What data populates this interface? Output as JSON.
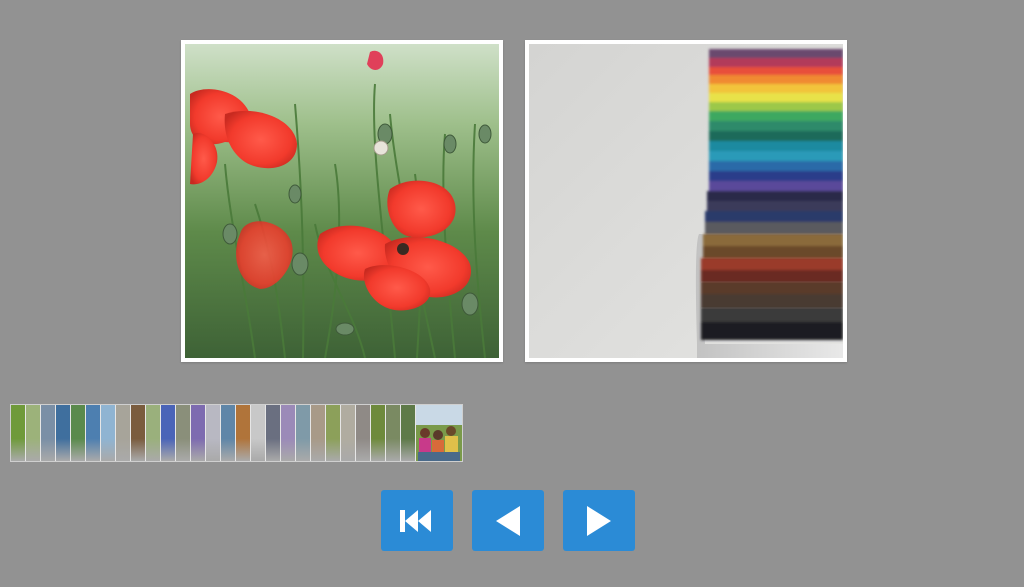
{
  "gallery": {
    "slides": [
      {
        "subject": "red poppies in green meadow"
      },
      {
        "subject": "colored pencils in tin"
      }
    ],
    "thumbnails": [
      {
        "color": "#6f9a3a"
      },
      {
        "color": "#9cb27a"
      },
      {
        "color": "#7a8fa6"
      },
      {
        "color": "#3f6f9e"
      },
      {
        "color": "#5a8a4c"
      },
      {
        "color": "#4d7fb0"
      },
      {
        "color": "#8fb4d2"
      },
      {
        "color": "#a7a49a"
      },
      {
        "color": "#7a5c3e"
      },
      {
        "color": "#9ab07c"
      },
      {
        "color": "#4a64b8"
      },
      {
        "color": "#8a8f7a"
      },
      {
        "color": "#7d6bb0"
      },
      {
        "color": "#b8b8c2"
      },
      {
        "color": "#5f86a8"
      },
      {
        "color": "#b0743a"
      },
      {
        "color": "#c8c8c8"
      },
      {
        "color": "#6a6f80"
      },
      {
        "color": "#9b8ab8"
      },
      {
        "color": "#7f9aa8"
      },
      {
        "color": "#a89a88"
      },
      {
        "color": "#8ca05a"
      },
      {
        "color": "#b0aca0"
      },
      {
        "color": "#8f8a86"
      },
      {
        "color": "#6e8a3c"
      },
      {
        "color": "#7a8a62"
      },
      {
        "color": "#5e7a48"
      }
    ],
    "current_thumbnail": {
      "subject": "group of children"
    },
    "colors": {
      "background": "#929292",
      "button": "#2b8bd6",
      "icon": "#ffffff"
    }
  },
  "controls": {
    "first": {
      "icon": "skip-to-first-icon"
    },
    "prev": {
      "icon": "previous-triangle-icon"
    },
    "next": {
      "icon": "next-triangle-icon"
    }
  }
}
